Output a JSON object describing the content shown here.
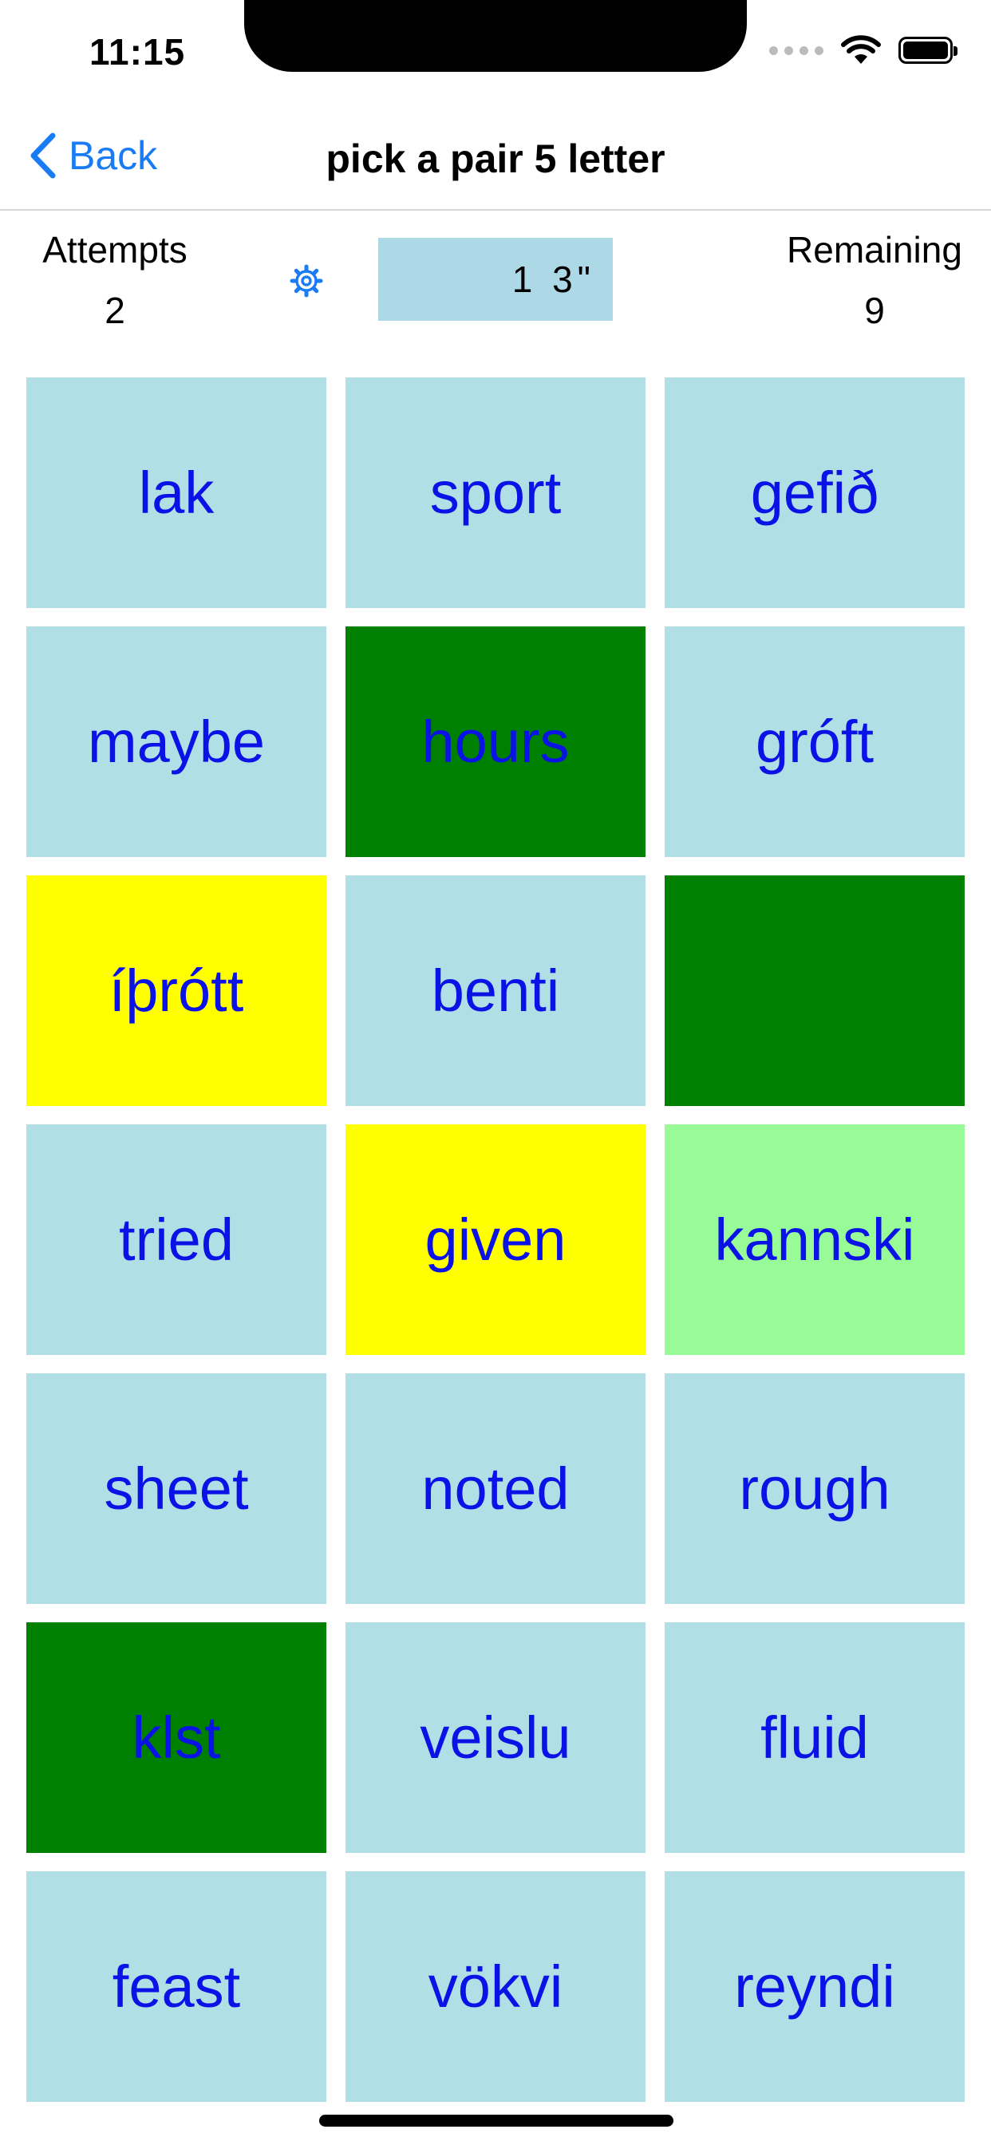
{
  "status_bar": {
    "time": "11:15"
  },
  "nav": {
    "back_label": "Back",
    "title": "pick a pair 5 letter"
  },
  "stats": {
    "attempts_label": "Attempts",
    "attempts_value": "2",
    "timer": "1 3\"",
    "remaining_label": "Remaining",
    "remaining_value": "9"
  },
  "colors": {
    "accent": "#1a7cf4",
    "tile_default": "#b0dfe6",
    "tile_matched": "#008000",
    "tile_selected": "#ffff00",
    "tile_hint": "#98fb98",
    "tile_text": "#0b12e6",
    "timer_bg": "#add8e6"
  },
  "tiles": [
    {
      "word": "lak",
      "state": "default"
    },
    {
      "word": "sport",
      "state": "default"
    },
    {
      "word": "gefið",
      "state": "default"
    },
    {
      "word": "maybe",
      "state": "default"
    },
    {
      "word": "hours",
      "state": "matched"
    },
    {
      "word": "gróft",
      "state": "default"
    },
    {
      "word": "íþrótt",
      "state": "selected"
    },
    {
      "word": "benti",
      "state": "default"
    },
    {
      "word": "",
      "state": "matched"
    },
    {
      "word": "tried",
      "state": "default"
    },
    {
      "word": "given",
      "state": "selected"
    },
    {
      "word": "kannski",
      "state": "hint"
    },
    {
      "word": "sheet",
      "state": "default"
    },
    {
      "word": "noted",
      "state": "default"
    },
    {
      "word": "rough",
      "state": "default"
    },
    {
      "word": "klst",
      "state": "matched"
    },
    {
      "word": "veislu",
      "state": "default"
    },
    {
      "word": "fluid",
      "state": "default"
    },
    {
      "word": "feast",
      "state": "default"
    },
    {
      "word": "vökvi",
      "state": "default"
    },
    {
      "word": "reyndi",
      "state": "default"
    }
  ]
}
